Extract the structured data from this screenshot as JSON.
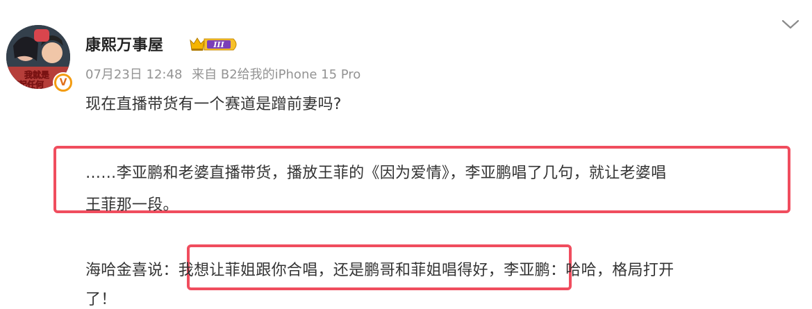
{
  "post": {
    "author": {
      "name": "康熙万事屋",
      "avatar_caption": "我就是不起任何",
      "verified_icon": "verified-v-icon",
      "badge_icon": "crown-level-badge-icon",
      "badge_text": "III"
    },
    "meta": {
      "time": "07月23日 12:48",
      "source": "来自 B2给我的iPhone 15 Pro"
    },
    "content": {
      "line1": "现在直播带货有一个赛道是蹭前妻吗?",
      "quote_line1": "……李亚鹏和老婆直播带货，播放王菲的《因为爱情》，李亚鹏唱了几句，就让老婆唱",
      "quote_line2": "王菲那一段。",
      "line4": "海哈金喜说：我想让菲姐跟你合唱，还是鹏哥和菲姐唱得好，李亚鹏：哈哈，格局打开",
      "line5": "了！"
    },
    "menu_icon": "chevron-down-icon"
  },
  "colors": {
    "highlight_border": "#f04d5e",
    "meta_text": "#939393",
    "badge_gold": "#f5b400",
    "badge_purple": "#7b3fb8"
  }
}
